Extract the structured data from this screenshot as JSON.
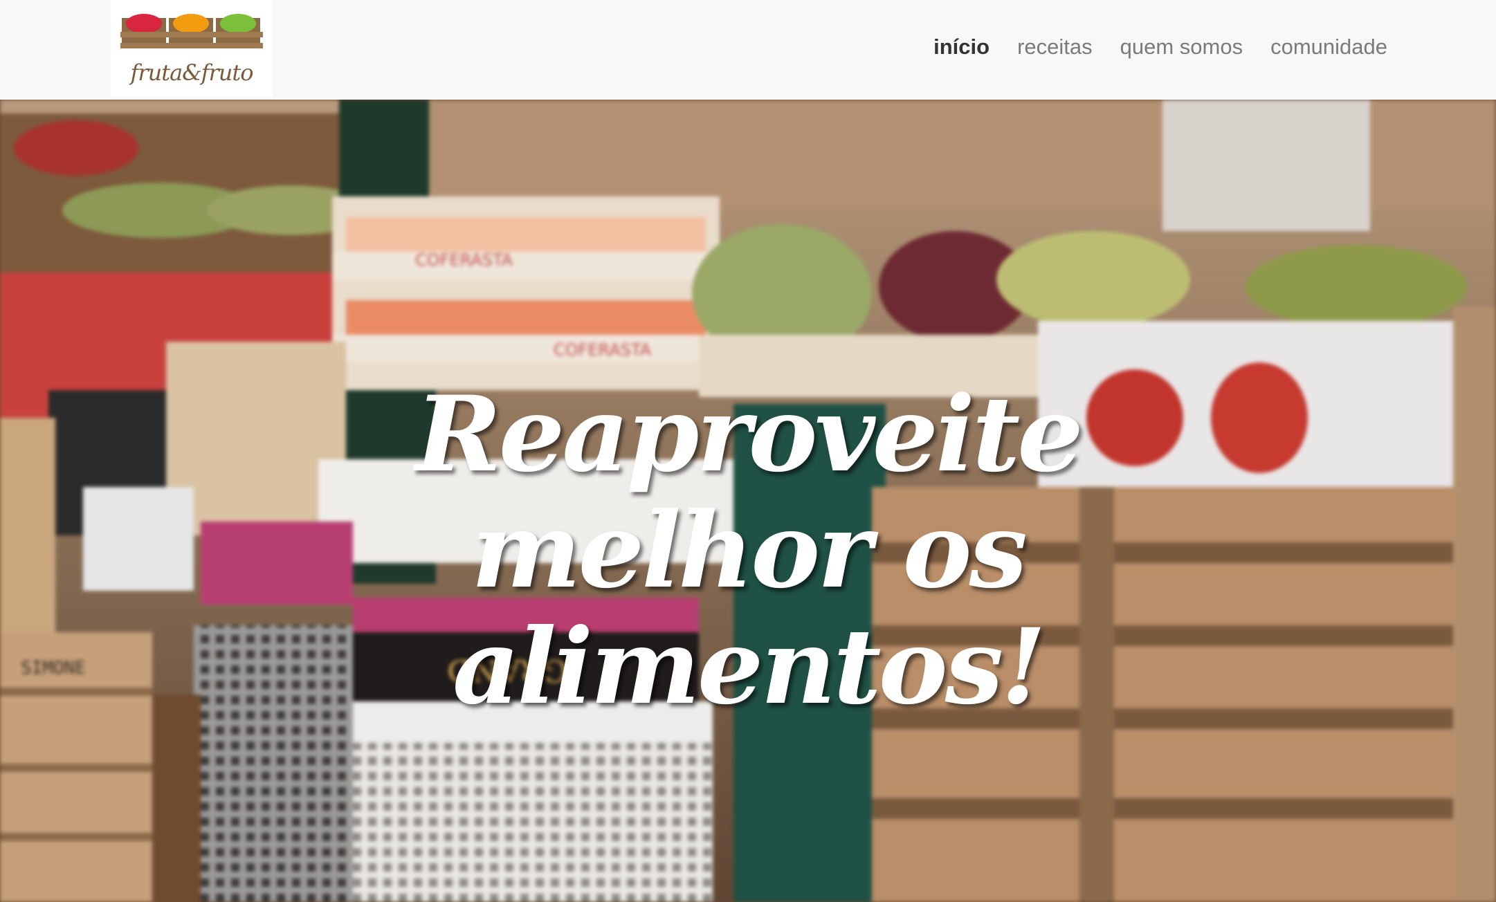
{
  "brand": {
    "name": "fruta&fruto"
  },
  "nav": {
    "items": [
      {
        "label": "início",
        "active": true
      },
      {
        "label": "receitas",
        "active": false
      },
      {
        "label": "quem somos",
        "active": false
      },
      {
        "label": "comunidade",
        "active": false
      }
    ]
  },
  "hero": {
    "title": "Reaproveite melhor os alimentos!",
    "crate_labels": [
      "COFERASTA",
      "COFERASTA",
      "SIMONE",
      "GRAND"
    ]
  },
  "colors": {
    "navbar_bg": "#f8f8f8",
    "nav_active": "#333333",
    "nav_inactive": "#7a7a7a",
    "hero_text": "#ffffff"
  }
}
